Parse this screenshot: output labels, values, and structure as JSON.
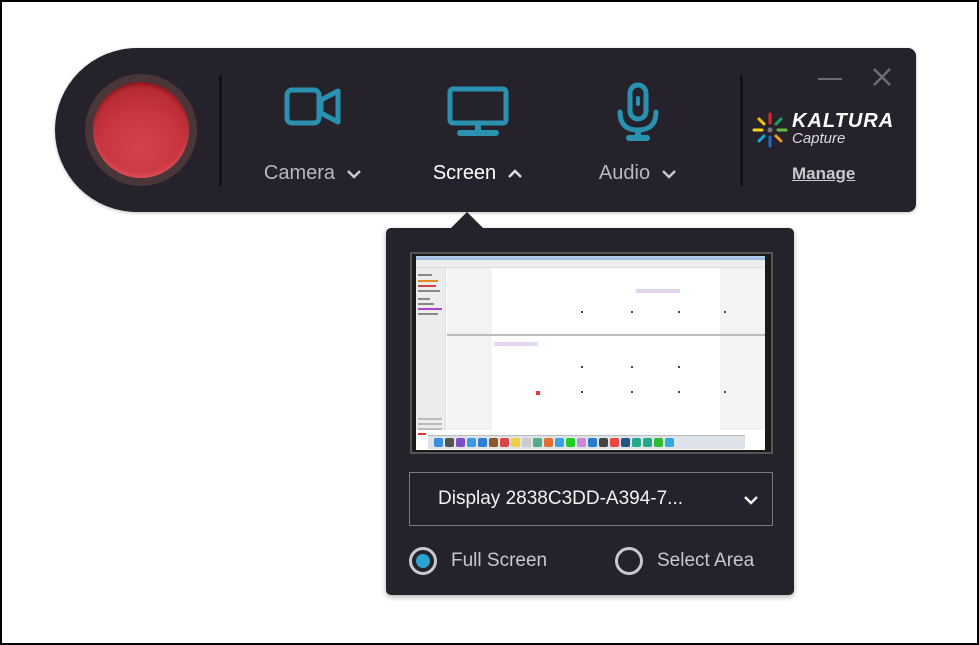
{
  "app": {
    "brand": "KALTURA",
    "brand_sub": "Capture",
    "manage_label": "Manage"
  },
  "toolbar": {
    "record_button": "record",
    "tools": [
      {
        "id": "camera",
        "label": "Camera",
        "icon": "video-camera-icon",
        "expanded": false
      },
      {
        "id": "screen",
        "label": "Screen",
        "icon": "monitor-icon",
        "expanded": true
      },
      {
        "id": "audio",
        "label": "Audio",
        "icon": "microphone-icon",
        "expanded": false
      }
    ],
    "window_controls": [
      "minimize",
      "close"
    ]
  },
  "screen_popup": {
    "display_selected": "Display 2838C3DD-A394-7...",
    "options": [
      {
        "label": "Full Screen",
        "selected": true
      },
      {
        "label": "Select Area",
        "selected": false
      }
    ]
  },
  "colors": {
    "accent": "#2a91b1",
    "panel_bg": "#25222b",
    "record_red": "#c93640",
    "radio_selected": "#2aa3d1"
  }
}
